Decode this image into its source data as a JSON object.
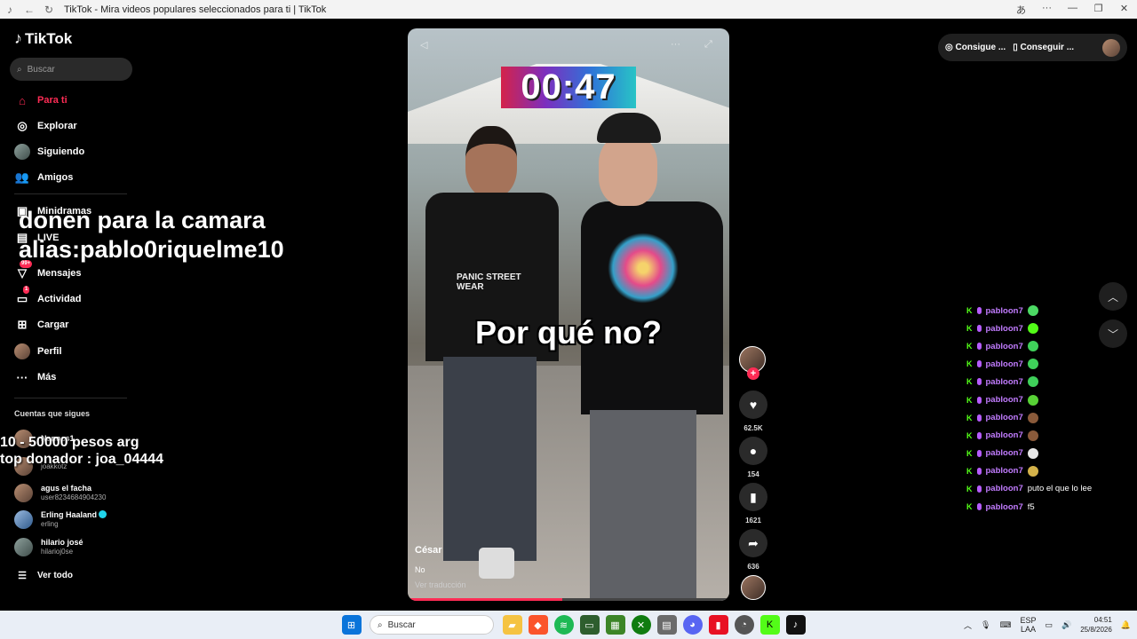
{
  "browser": {
    "title": "TikTok - Mira videos populares seleccionados para ti | TikTok"
  },
  "sidebar": {
    "logo": "TikTok",
    "search_placeholder": "Buscar",
    "nav": [
      {
        "label": "Para ti",
        "icon": "home-icon",
        "active": true
      },
      {
        "label": "Explorar",
        "icon": "compass-icon"
      },
      {
        "label": "Siguiendo",
        "icon": "following-avatar-icon"
      },
      {
        "label": "Amigos",
        "icon": "friends-icon"
      },
      {
        "label": "Minidramas",
        "icon": "minidramas-icon"
      },
      {
        "label": "LIVE",
        "icon": "live-icon"
      },
      {
        "label": "Mensajes",
        "icon": "messages-icon",
        "badge": "99+"
      },
      {
        "label": "Actividad",
        "icon": "activity-icon",
        "badge": "1"
      },
      {
        "label": "Cargar",
        "icon": "upload-icon"
      },
      {
        "label": "Perfil",
        "icon": "profile-avatar-icon"
      },
      {
        "label": "Más",
        "icon": "more-icon"
      }
    ],
    "following_title": "Cuentas que sigues",
    "accounts": [
      {
        "name": "Nanocs1",
        "user": ""
      },
      {
        "name": "",
        "user": "joakkotz"
      },
      {
        "name": "agus el facha",
        "user": "user8234684904230"
      },
      {
        "name": "Erling Haaland",
        "user": "erling",
        "verified": true
      },
      {
        "name": "hilario josé",
        "user": "hilarioj0se"
      }
    ],
    "see_all": "Ver todo"
  },
  "overlay": {
    "line1": "donen para la camara",
    "line2": "alias:pablo0riquelme10",
    "line3": "10 - 50000 pesos arg",
    "line4": "top donador : joa_04444"
  },
  "video": {
    "timer": "00:47",
    "caption": "Por qué no?",
    "shirt_text": "PANIC STREET WEAR",
    "author": "César",
    "description": "No",
    "translate": "Ver traducción",
    "progress": 0.48
  },
  "actions": {
    "likes": "62.5K",
    "comments": "154",
    "saves": "1621",
    "shares": "636"
  },
  "topbar": {
    "coins": "Consigue ...",
    "app": "Conseguir ..."
  },
  "chat": [
    {
      "user": "pabloon7",
      "text": "",
      "emote": "#4cd964"
    },
    {
      "user": "pabloon7",
      "text": "",
      "emote": "#53fc18"
    },
    {
      "user": "pabloon7",
      "text": "",
      "emote": "#3fd05a"
    },
    {
      "user": "pabloon7",
      "text": "",
      "emote": "#3fd05a"
    },
    {
      "user": "pabloon7",
      "text": "",
      "emote": "#3fd05a"
    },
    {
      "user": "pabloon7",
      "text": "",
      "emote": "#58d136"
    },
    {
      "user": "pabloon7",
      "text": "",
      "emote": "#8a5a3a"
    },
    {
      "user": "pabloon7",
      "text": "",
      "emote": "#8a5a3a"
    },
    {
      "user": "pabloon7",
      "text": "",
      "emote": "#e8e8e8"
    },
    {
      "user": "pabloon7",
      "text": "",
      "emote": "#d4b24a"
    },
    {
      "user": "pabloon7",
      "text": "puto el que lo lee",
      "emote": ""
    },
    {
      "user": "pabloon7",
      "text": "f5",
      "emote": ""
    }
  ],
  "taskbar": {
    "search": "Buscar",
    "lang1": "ESP",
    "lang2": "LAA",
    "time": "04:51",
    "date": "25/8/2026"
  },
  "colors": {
    "accent": "#fe2c55",
    "chat_user": "#c27cff",
    "kick": "#53fc18"
  }
}
